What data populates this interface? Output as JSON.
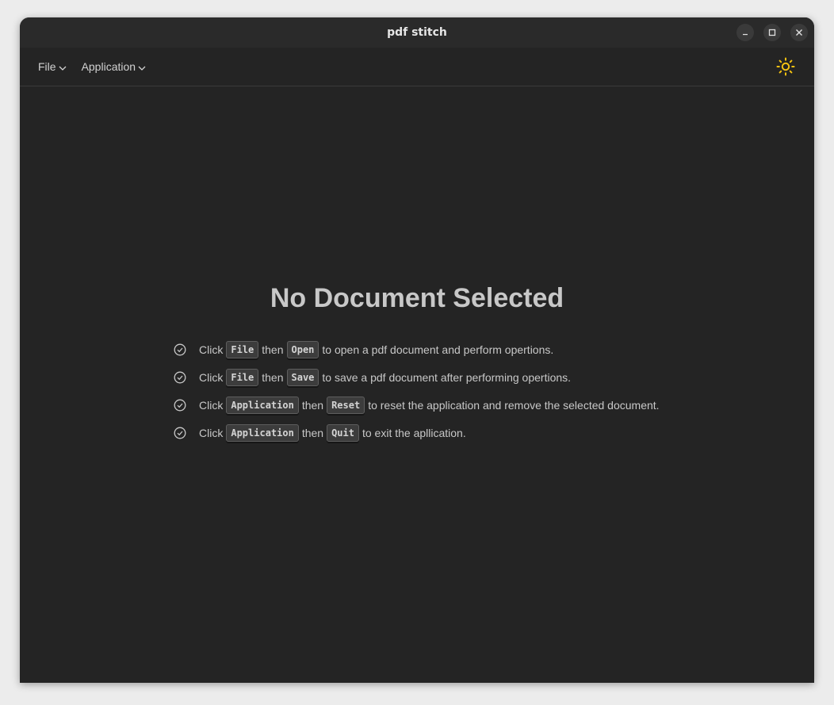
{
  "window": {
    "title": "pdf stitch"
  },
  "menubar": {
    "items": [
      {
        "label": "File"
      },
      {
        "label": "Application"
      }
    ]
  },
  "icons": {
    "theme": "sun-icon",
    "check": "check-circle-icon",
    "minimize": "minimize-icon",
    "maximize": "maximize-icon",
    "close": "close-icon",
    "chevron": "chevron-down-icon"
  },
  "colors": {
    "background": "#242424",
    "accent_sun": "#f5c211",
    "text": "#c8c8c8"
  },
  "main": {
    "heading": "No Document Selected",
    "instructions": [
      {
        "click": "Click",
        "key1": "File",
        "then": "then",
        "key2": "Open",
        "rest": "to open a pdf document and perform opertions."
      },
      {
        "click": "Click",
        "key1": "File",
        "then": "then",
        "key2": "Save",
        "rest": "to save a pdf document after performing opertions."
      },
      {
        "click": "Click",
        "key1": "Application",
        "then": "then",
        "key2": "Reset",
        "rest": "to reset the application and remove the selected document."
      },
      {
        "click": "Click",
        "key1": "Application",
        "then": "then",
        "key2": "Quit",
        "rest": "to exit the apllication."
      }
    ]
  }
}
